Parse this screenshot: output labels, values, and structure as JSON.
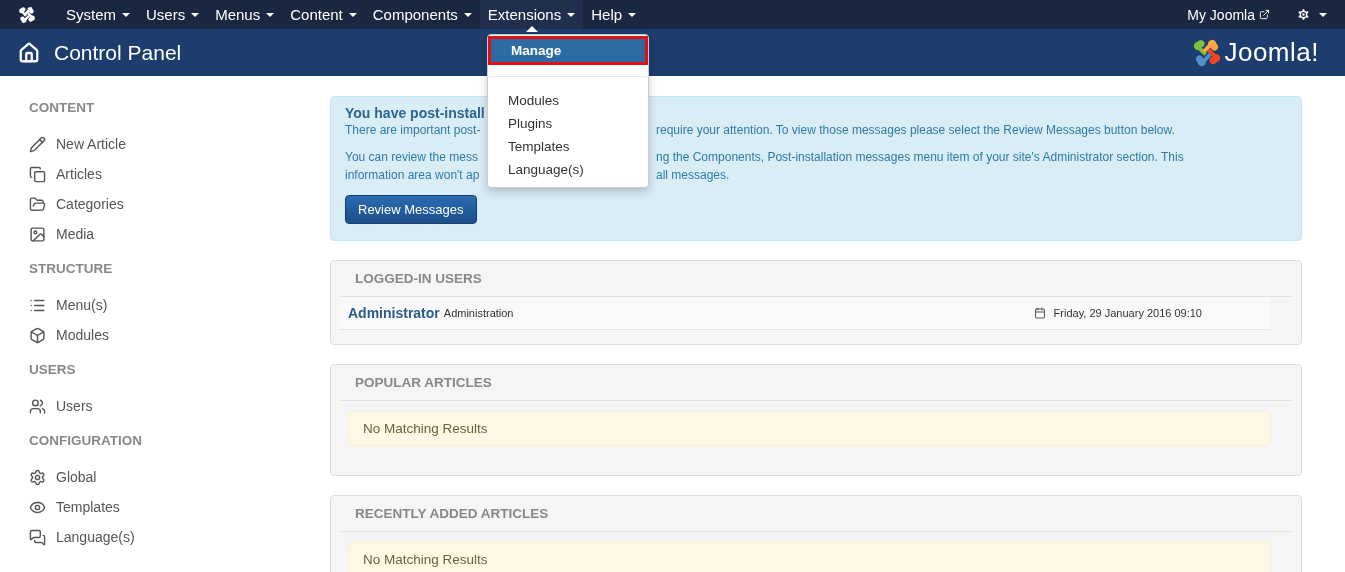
{
  "top_menu": [
    {
      "label": "System",
      "expanded": false
    },
    {
      "label": "Users",
      "expanded": false
    },
    {
      "label": "Menus",
      "expanded": false
    },
    {
      "label": "Content",
      "expanded": false
    },
    {
      "label": "Components",
      "expanded": false
    },
    {
      "label": "Extensions",
      "expanded": true
    },
    {
      "label": "Help",
      "expanded": false
    }
  ],
  "top_right": {
    "link": "My Joomla"
  },
  "header": {
    "title": "Control Panel",
    "logo_text": "Joomla!"
  },
  "dropdown": [
    {
      "kind": "item",
      "label": "Manage",
      "selected": true
    },
    {
      "kind": "divider"
    },
    {
      "kind": "item",
      "label": "Modules",
      "selected": false
    },
    {
      "kind": "item",
      "label": "Plugins",
      "selected": false
    },
    {
      "kind": "item",
      "label": "Templates",
      "selected": false
    },
    {
      "kind": "item",
      "label": "Language(s)",
      "selected": false
    }
  ],
  "sidebar": [
    {
      "heading": "CONTENT",
      "items": [
        "New Article",
        "Articles",
        "Categories",
        "Media"
      ]
    },
    {
      "heading": "STRUCTURE",
      "items": [
        "Menu(s)",
        "Modules"
      ]
    },
    {
      "heading": "USERS",
      "items": [
        "Users"
      ]
    },
    {
      "heading": "CONFIGURATION",
      "items": [
        "Global",
        "Templates",
        "Language(s)"
      ]
    }
  ],
  "alert": {
    "title": "You have post-install",
    "lines": [
      {
        "left": "There are important post-",
        "right": "require your attention. To view those messages please select the Review Messages button below."
      },
      {
        "left": "You can review the mess",
        "right": "ng the Components, Post-installation messages menu item of your site's Administrator section. This"
      },
      {
        "left": "information area won't ap",
        "right": "all messages."
      }
    ],
    "button": "Review Messages"
  },
  "panels": [
    {
      "title": "LOGGED-IN USERS",
      "kind": "users",
      "rows": [
        {
          "name": "Administrator",
          "area": "Administration",
          "date": "Friday, 29 January 2016 09:10"
        }
      ]
    },
    {
      "title": "POPULAR ARTICLES",
      "kind": "empty",
      "message": "No Matching Results"
    },
    {
      "title": "RECENTLY ADDED ARTICLES",
      "kind": "empty",
      "message": "No Matching Results"
    }
  ]
}
